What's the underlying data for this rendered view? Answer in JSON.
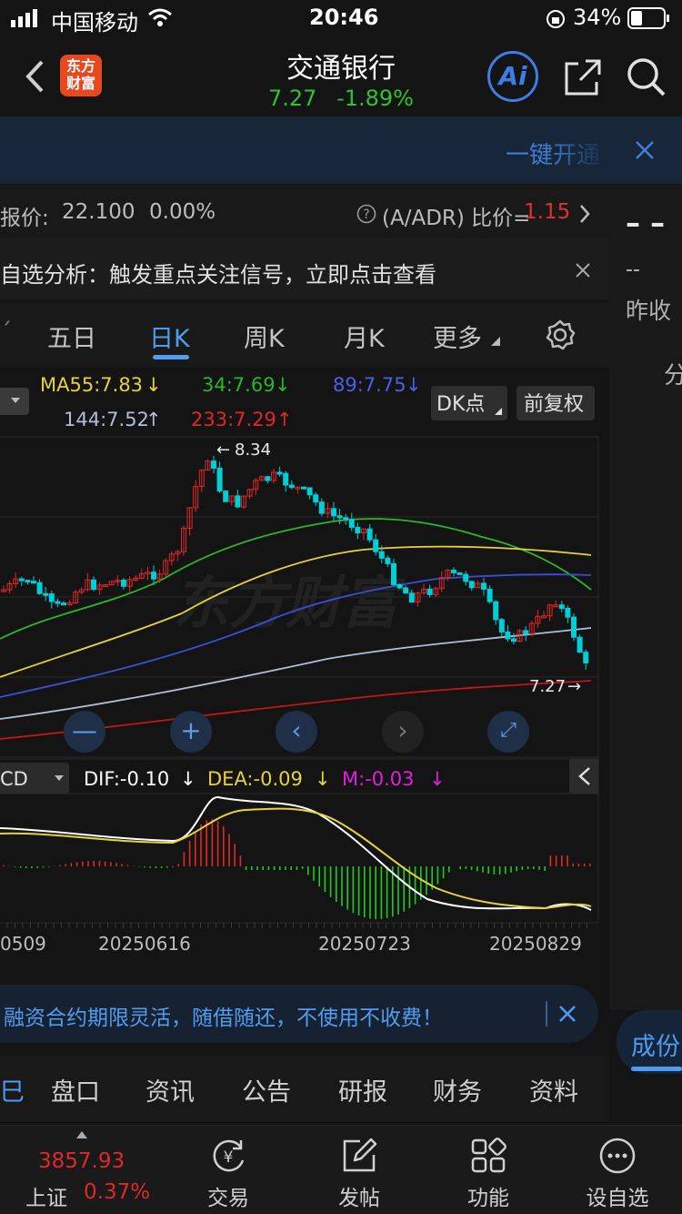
{
  "status_bar": {
    "carrier": "中国移动",
    "time": "20:46",
    "battery": "34%"
  },
  "header": {
    "logo_text_line1": "东方",
    "logo_text_line2": "财富",
    "stock_name": "交通银行",
    "price": "7.27",
    "change_pct": "-1.89%",
    "ai_label": "Ai"
  },
  "banner": {
    "action_text": "一键开通"
  },
  "info_bar": {
    "price_label": "报价:",
    "price_value": "22.100",
    "price_change": "0.00%",
    "adr_label": "(A/ADR) 比价=",
    "adr_value": "1.15"
  },
  "notice_bar": {
    "text": "自选分析：触发重点关注信号，立即点击查看"
  },
  "right_panel": {
    "dash_big": "– –",
    "dash_small": "--",
    "label": "昨收",
    "partial_char": "分",
    "tab_partial": "成份"
  },
  "period_tabs": [
    {
      "label": "五日"
    },
    {
      "label": "日K"
    },
    {
      "label": "周K"
    },
    {
      "label": "月K"
    },
    {
      "label": "更多"
    }
  ],
  "ma_legend": {
    "ma55": "MA55:7.83",
    "ma34": "34:7.69",
    "ma89": "89:7.75",
    "ma144": "144:7.52",
    "ma233": "233:7.29",
    "dk_button": "DK点",
    "adjust_button": "前复权"
  },
  "price_chart": {
    "high_label": "8.34",
    "last_label": "7.27",
    "watermark": "东方财富",
    "up_color": "#e02828",
    "down_color": "#00cfd8",
    "ma_colors": {
      "ma55": "#e6d23c",
      "ma34": "#2bb52b",
      "ma89": "#3a4fd8",
      "ma144": "#b0bed8",
      "ma233": "#c01818"
    }
  },
  "macd_legend": {
    "indicator": "CD",
    "dif": "DIF:-0.10",
    "dea": "DEA:-0.09",
    "m": "M:-0.03"
  },
  "date_axis": [
    "0509",
    "20250616",
    "20250723",
    "20250829"
  ],
  "promo": {
    "text": "融资合约期限灵活，随借随还，不使用不收费！"
  },
  "sub_tabs": [
    {
      "label": "盘口"
    },
    {
      "label": "资讯"
    },
    {
      "label": "公告"
    },
    {
      "label": "研报"
    },
    {
      "label": "财务"
    },
    {
      "label": "资料"
    }
  ],
  "bottom_nav": {
    "index_value": "3857.93",
    "index_name": "上证",
    "index_change": "0.37%",
    "items": [
      {
        "label": "交易"
      },
      {
        "label": "发帖"
      },
      {
        "label": "功能"
      },
      {
        "label": "设自选"
      }
    ]
  }
}
